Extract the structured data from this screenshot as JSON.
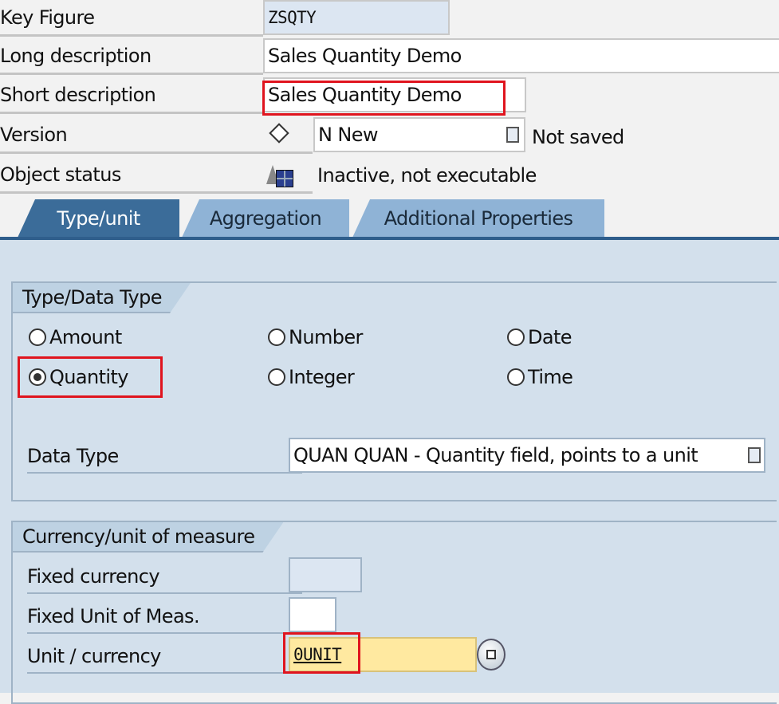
{
  "header": {
    "key_figure": {
      "label": "Key Figure",
      "value": "ZSQTY"
    },
    "long_description": {
      "label": "Long description",
      "value": "Sales Quantity Demo"
    },
    "short_description": {
      "label": "Short description",
      "value": "Sales Quantity Demo"
    },
    "version": {
      "label": "Version",
      "value": "N New",
      "status": "Not saved"
    },
    "object_status": {
      "label": "Object status",
      "value": "Inactive, not executable"
    }
  },
  "tabs": [
    {
      "label": "Type/unit",
      "active": true
    },
    {
      "label": "Aggregation"
    },
    {
      "label": "Additional Properties"
    }
  ],
  "type_group": {
    "title": "Type/Data Type",
    "options": [
      {
        "label": "Amount"
      },
      {
        "label": "Number"
      },
      {
        "label": "Date"
      },
      {
        "label": "Quantity",
        "selected": true
      },
      {
        "label": "Integer"
      },
      {
        "label": "Time"
      }
    ],
    "data_type": {
      "label": "Data Type",
      "value": "QUAN QUAN - Quantity field, points to a unit"
    }
  },
  "currency_group": {
    "title": "Currency/unit of measure",
    "fixed_currency": {
      "label": "Fixed currency",
      "value": ""
    },
    "fixed_unit": {
      "label": "Fixed Unit of Meas.",
      "value": ""
    },
    "unit_currency": {
      "label": "Unit / currency",
      "value": "0UNIT"
    }
  },
  "colors": {
    "highlight": "#e0141e",
    "required_field": "#ffe9a0",
    "active_tab": "#3b6c99"
  }
}
